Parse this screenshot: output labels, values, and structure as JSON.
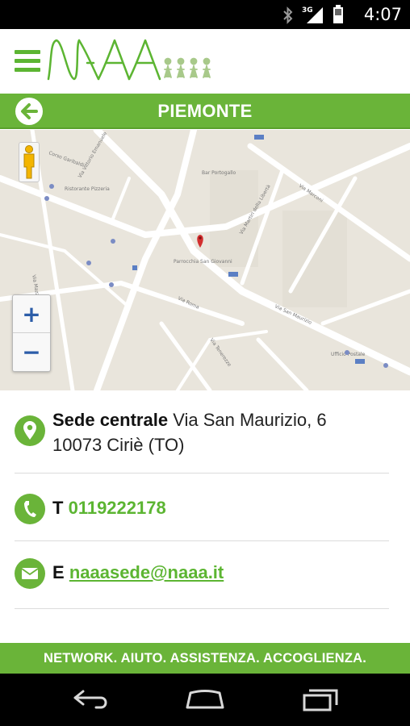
{
  "status_bar": {
    "time": "4:07",
    "network": "3G",
    "icons": [
      "bluetooth-icon",
      "signal-icon",
      "battery-icon"
    ]
  },
  "header": {
    "logo_text": "NAAA",
    "menu_icon": "menu-icon"
  },
  "title_bar": {
    "title": "PIEMONTE",
    "back_icon": "back-arrow-icon"
  },
  "map": {
    "zoom_in_label": "+",
    "zoom_out_label": "−",
    "street_labels": [
      "Corso Garibaldi",
      "Via Roma",
      "Via San Maurizio",
      "Via Vittorio Emanuele",
      "Via Tenerezze",
      "Via Mazzini",
      "Via Marconi",
      "Via Martiri della Libertà"
    ],
    "poi_labels": [
      "Bar Portogallo",
      "Parrocchia San Giovanni",
      "Ufficio Postale",
      "Ristorante Pizzeria"
    ]
  },
  "contact": {
    "address_label": "Sede centrale",
    "address_line1": "Via San Maurizio, 6",
    "address_line2": "10073 Ciriè (TO)",
    "phone_prefix": "T",
    "phone": "0119222178",
    "email_prefix": "E",
    "email": "naaasede@naaa.it"
  },
  "footer": {
    "slogan": "NETWORK. AIUTO. ASSISTENZA. ACCOGLIENZA."
  },
  "colors": {
    "brand_green": "#6ab439",
    "link_green": "#5cb532",
    "map_bg": "#e9e5dc",
    "road": "#ffffff"
  }
}
